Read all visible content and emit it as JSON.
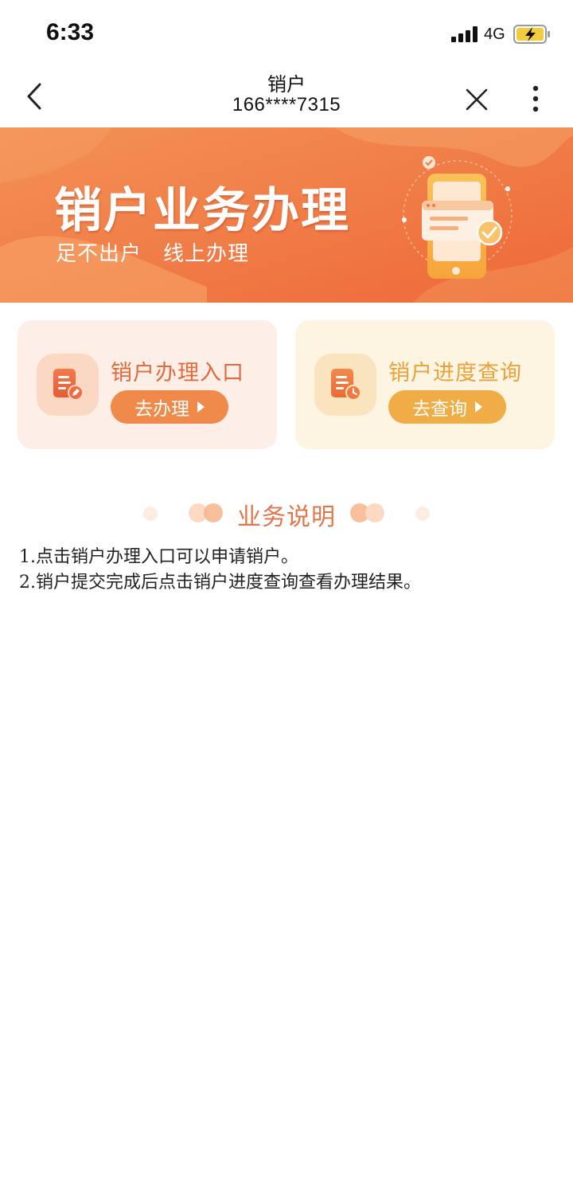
{
  "status_bar": {
    "time": "6:33",
    "network": "4G",
    "icons": [
      "signal-icon",
      "battery-charging-icon"
    ]
  },
  "nav": {
    "title": "销户",
    "subtitle": "166****7315",
    "icons": [
      "back-chevron-icon",
      "close-icon",
      "more-vertical-icon"
    ]
  },
  "banner": {
    "title": "销户业务办理",
    "subtitle": "足不出户　线上办理",
    "colors": {
      "start": "#f28a4f",
      "end": "#ee6a3a"
    }
  },
  "cards": [
    {
      "title": "销户办理入口",
      "button": "去办理",
      "icon": "document-edit-icon",
      "accent": "#e06a3c"
    },
    {
      "title": "销户进度查询",
      "button": "去查询",
      "icon": "document-clock-icon",
      "accent": "#e9a23a"
    }
  ],
  "section": {
    "title": "业务说明",
    "lines": [
      "1.点击销户办理入口可以申请销户。",
      "2.销户提交完成后点击销户进度查询查看办理结果。"
    ]
  }
}
